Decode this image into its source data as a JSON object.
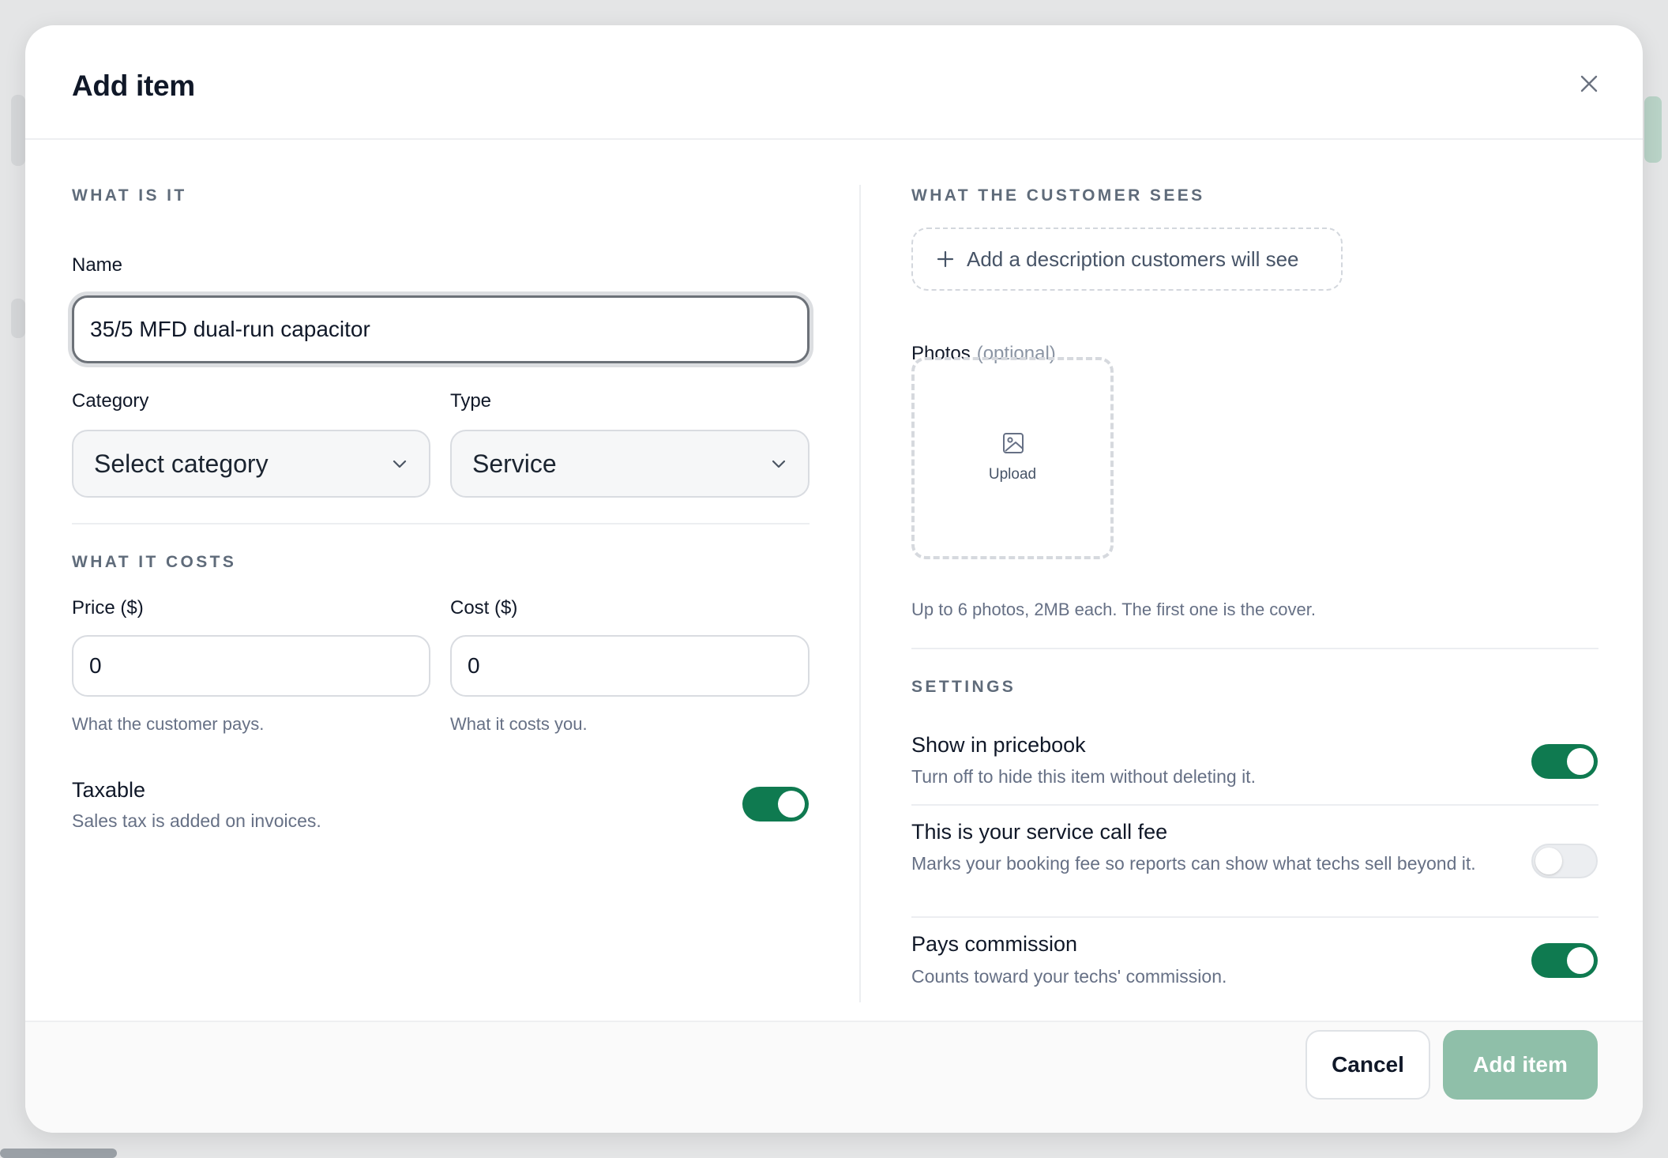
{
  "modal": {
    "title": "Add item",
    "close_icon": "close-icon"
  },
  "what_is_it": {
    "section_label": "WHAT IS IT",
    "name_label": "Name",
    "name_value": "35/5 MFD dual-run capacitor",
    "category_label": "Category",
    "category_value": "Select category",
    "type_label": "Type",
    "type_value": "Service"
  },
  "what_it_costs": {
    "section_label": "WHAT IT COSTS",
    "price_label": "Price ($)",
    "price_value": "0",
    "price_help": "What the customer pays.",
    "cost_label": "Cost ($)",
    "cost_value": "0",
    "cost_help": "What it costs you.",
    "taxable_title": "Taxable",
    "taxable_desc": "Sales tax is added on invoices.",
    "taxable_on": true
  },
  "customer_sees": {
    "section_label": "WHAT THE CUSTOMER SEES",
    "add_description": "Add a description customers will see",
    "photos_label": "Photos",
    "photos_optional": "(optional)",
    "upload_label": "Upload",
    "photos_help": "Up to 6 photos, 2MB each. The first one is the cover."
  },
  "settings": {
    "section_label": "SETTINGS",
    "items": [
      {
        "title": "Show in pricebook",
        "desc": "Turn off to hide this item without deleting it.",
        "on": true
      },
      {
        "title": "This is your service call fee",
        "desc": "Marks your booking fee so reports can show what techs sell beyond it.",
        "on": false
      },
      {
        "title": "Pays commission",
        "desc": "Counts toward your techs' commission.",
        "on": true
      }
    ]
  },
  "footer": {
    "cancel_label": "Cancel",
    "add_label": "Add item"
  },
  "colors": {
    "toggle_on": "#0f7a50",
    "primary_disabled": "#8fbfa9",
    "heading": "#101828",
    "muted": "#667085"
  }
}
